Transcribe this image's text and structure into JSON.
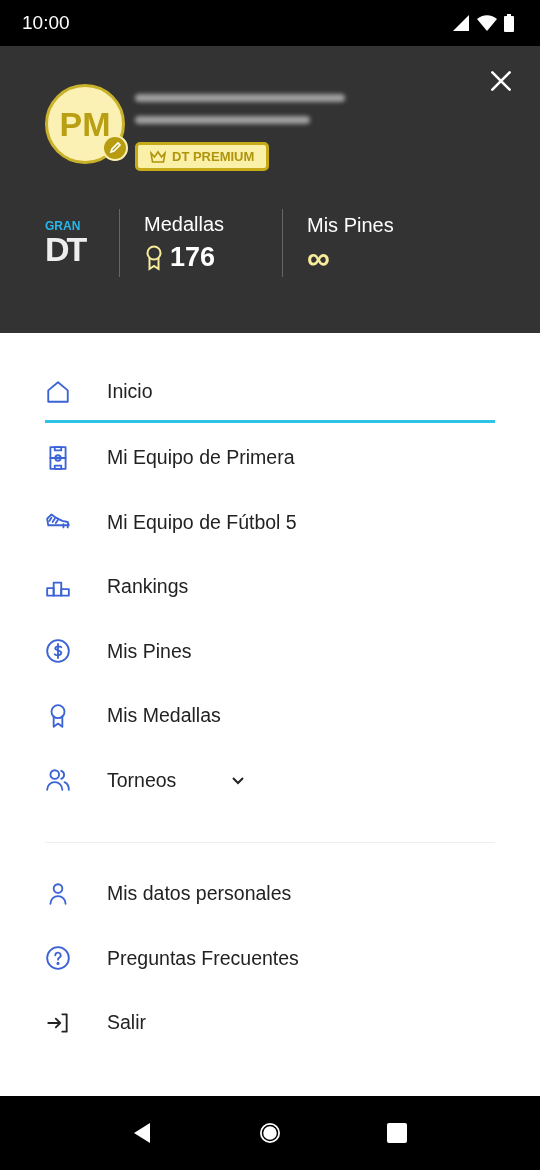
{
  "status_bar": {
    "time": "10:00"
  },
  "header": {
    "avatar_initials": "PM",
    "badge": "DT PREMIUM",
    "logo": {
      "top": "GRAN",
      "main": "DT"
    },
    "stats": [
      {
        "label": "Medallas",
        "value": "176",
        "kind": "medal"
      },
      {
        "label": "Mis Pines",
        "value": "∞",
        "kind": "plain"
      }
    ]
  },
  "menu": [
    {
      "label": "Inicio",
      "kind": "home",
      "selected": true
    },
    {
      "label": "Mi Equipo de Primera",
      "kind": "pitch",
      "selected": false
    },
    {
      "label": "Mi Equipo de Fútbol 5",
      "kind": "boot",
      "selected": false
    },
    {
      "label": "Rankings",
      "kind": "podium",
      "selected": false
    },
    {
      "label": "Mis Pines",
      "kind": "dollar",
      "selected": false
    },
    {
      "label": "Mis Medallas",
      "kind": "medal",
      "selected": false
    },
    {
      "label": "Torneos",
      "kind": "people",
      "selected": false,
      "expanded": false
    }
  ],
  "secondary_menu": [
    {
      "label": "Mis datos personales",
      "kind": "person",
      "selected": false
    },
    {
      "label": "Preguntas Frecuentes",
      "kind": "question",
      "selected": false
    },
    {
      "label": "Salir",
      "kind": "exit",
      "selected": false
    }
  ]
}
